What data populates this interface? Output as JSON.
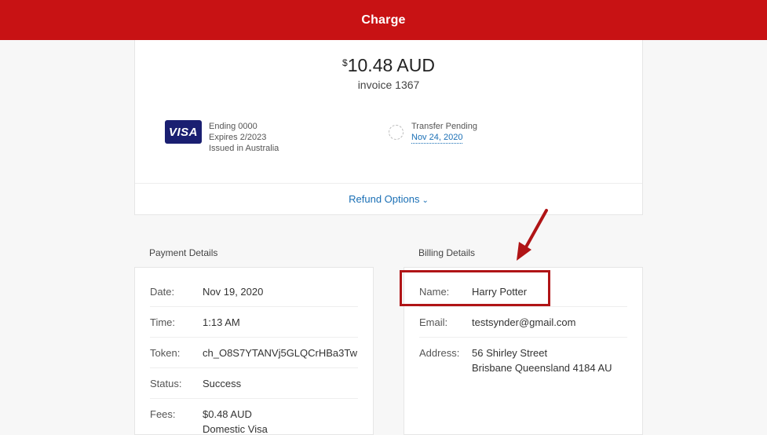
{
  "header": {
    "title": "Charge"
  },
  "summary": {
    "currency_symbol": "$",
    "amount": "10.48 AUD",
    "invoice": "invoice 1367",
    "card": {
      "brand": "VISA",
      "ending": "Ending 0000",
      "expires": "Expires 2/2023",
      "issued": "Issued in Australia"
    },
    "transfer": {
      "status": "Transfer Pending",
      "date": "Nov 24, 2020"
    },
    "refund_label": "Refund Options"
  },
  "payment_details": {
    "title": "Payment Details",
    "rows": [
      {
        "label": "Date:",
        "value": "Nov 19, 2020"
      },
      {
        "label": "Time:",
        "value": "1:13 AM"
      },
      {
        "label": "Token:",
        "value": "ch_O8S7YTANVj5GLQCrHBa3Tw"
      },
      {
        "label": "Status:",
        "value": "Success"
      },
      {
        "label": "Fees:",
        "value": "$0.48 AUD",
        "value2": "Domestic Visa"
      }
    ]
  },
  "billing_details": {
    "title": "Billing Details",
    "rows": [
      {
        "label": "Name:",
        "value": "Harry Potter"
      },
      {
        "label": "Email:",
        "value": "testsynder@gmail.com"
      },
      {
        "label": "Address:",
        "value": "56 Shirley Street",
        "value2": "Brisbane Queensland 4184 AU"
      }
    ]
  },
  "annotation_color": "#b01416",
  "brand_color": "#c81214",
  "link_color": "#1a6fb5"
}
